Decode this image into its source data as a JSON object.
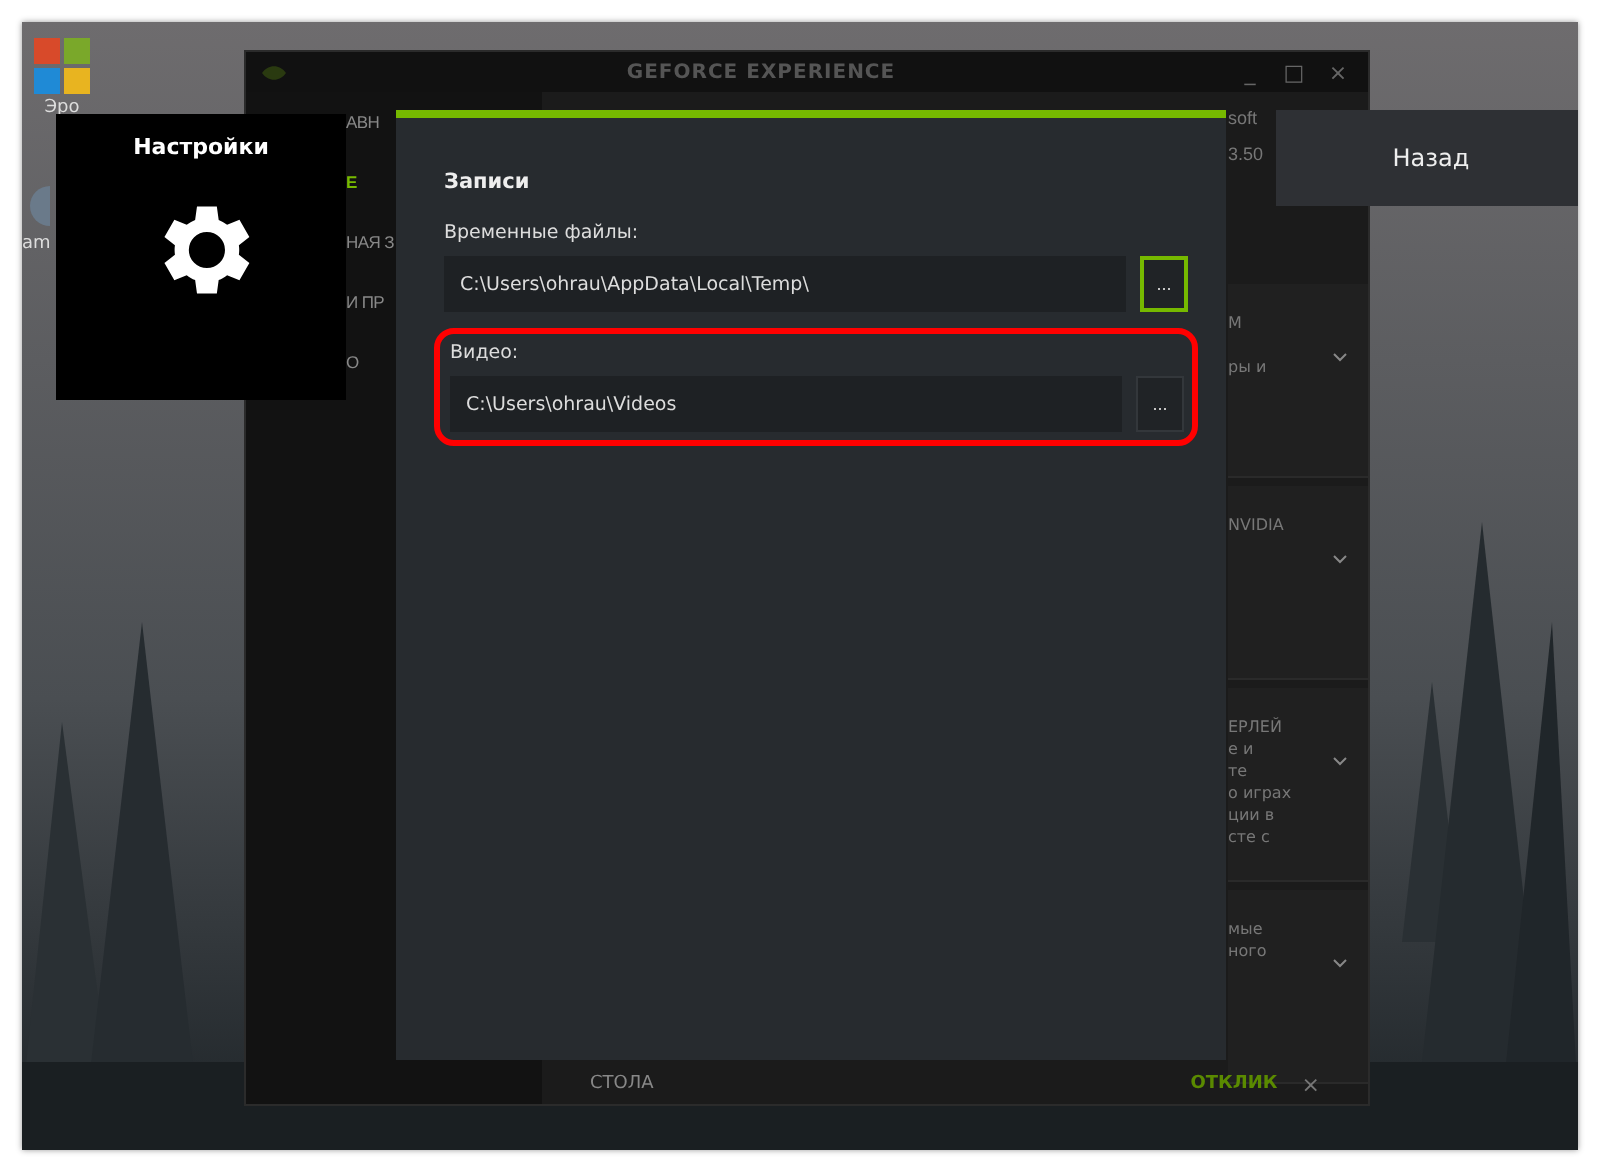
{
  "desktop": {
    "icons": [
      {
        "label": "Эро"
      },
      {
        "label": "am"
      }
    ]
  },
  "app_window": {
    "title": "GEFORCE EXPERIENCE",
    "controls": [
      "_",
      "□",
      "×"
    ],
    "nav": [
      {
        "label": "АВН"
      }
    ],
    "sidebar": [
      {
        "label": "E",
        "selected": true
      },
      {
        "label": "НАЯ З",
        "selected": false
      },
      {
        "label": "И ПР",
        "selected": false
      },
      {
        "label": "О",
        "selected": false
      }
    ],
    "account": "soft",
    "info": "3.50",
    "cards": [
      {
        "lines": [
          "М",
          "ры и"
        ]
      },
      {
        "lines": [
          "NVIDIA"
        ]
      },
      {
        "lines": [
          "ЕРЛЕЙ",
          "е и",
          "те",
          "о играх",
          "ции в",
          "сте с"
        ]
      },
      {
        "lines": [
          "мые",
          "ного"
        ]
      }
    ],
    "footer": {
      "left": "СТОЛА",
      "notice": "ОТКЛИК",
      "close": "×"
    }
  },
  "settings_tile": {
    "title": "Настройки"
  },
  "back_button": {
    "label": "Назад"
  },
  "dialog": {
    "section": "Записи",
    "fields": [
      {
        "label": "Временные файлы:",
        "value": "C:\\Users\\ohrau\\AppData\\Local\\Temp\\",
        "browse": "...",
        "focused": true,
        "highlighted": false
      },
      {
        "label": "Видео:",
        "value": "C:\\Users\\ohrau\\Videos",
        "browse": "...",
        "focused": false,
        "highlighted": true
      }
    ]
  }
}
